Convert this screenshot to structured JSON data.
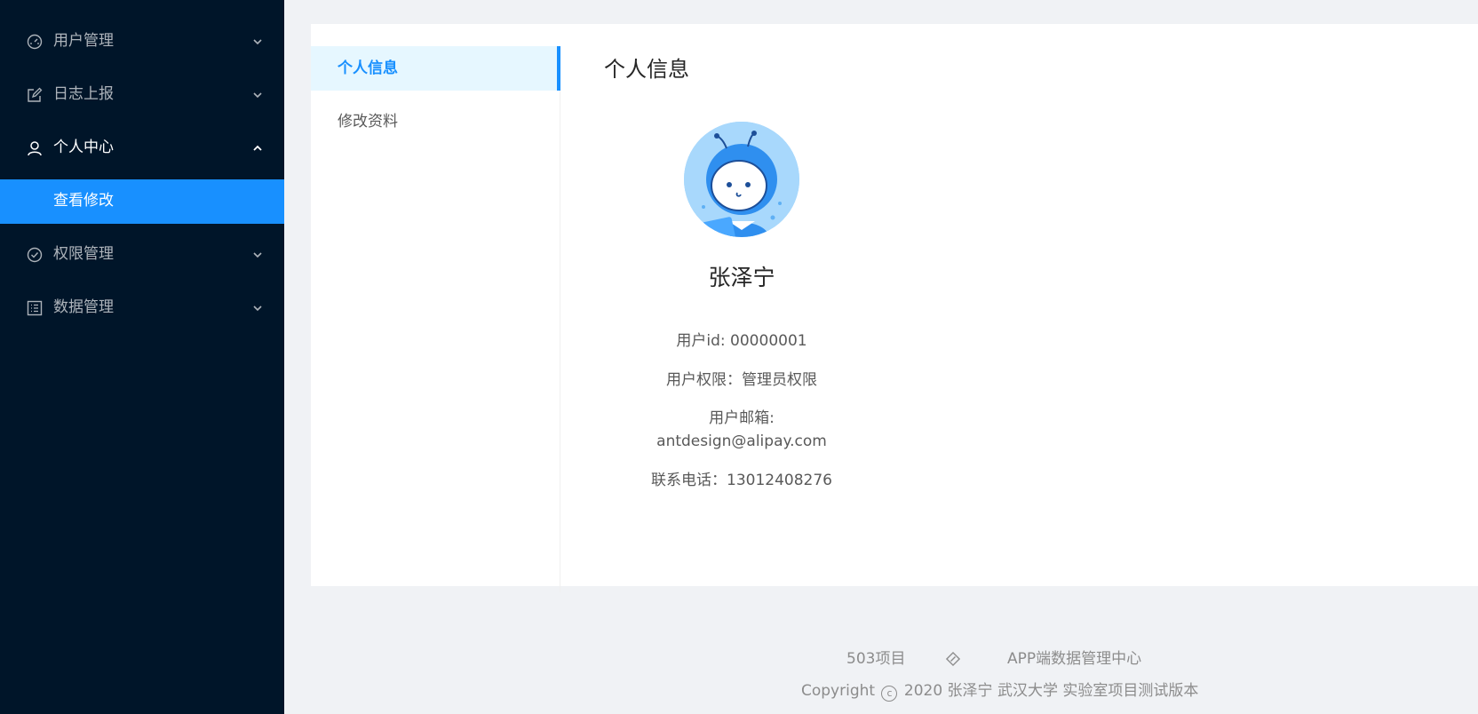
{
  "sidebar": {
    "items": [
      {
        "label": "用户管理",
        "icon": "dashboard-icon",
        "state": "collapsed"
      },
      {
        "label": "日志上报",
        "icon": "edit-icon",
        "state": "collapsed"
      },
      {
        "label": "个人中心",
        "icon": "user-icon",
        "state": "expanded",
        "children": [
          {
            "label": "查看修改",
            "selected": true
          }
        ]
      },
      {
        "label": "权限管理",
        "icon": "check-circle-icon",
        "state": "collapsed"
      },
      {
        "label": "数据管理",
        "icon": "profile-icon",
        "state": "collapsed"
      }
    ],
    "background": "#001529",
    "selected_color": "#1890ff"
  },
  "settings_menu": {
    "items": [
      {
        "label": "个人信息",
        "active": true
      },
      {
        "label": "修改资料",
        "active": false
      }
    ]
  },
  "profile": {
    "section_title": "个人信息",
    "avatar": "avatar-icon",
    "name": "张泽宁",
    "user_id": "用户id: 00000001",
    "permission": "用户权限：管理员权限",
    "email_label": "用户邮箱:",
    "email": "antdesign@alipay.com",
    "phone": "联系电话：13012408276"
  },
  "footer": {
    "links": [
      "503项目",
      "APP端数据管理中心"
    ],
    "link_icon": "compass-icon",
    "copyright_prefix": "Copyright",
    "copyright_text": "2020 张泽宁 武汉大学 实验室项目测试版本"
  }
}
